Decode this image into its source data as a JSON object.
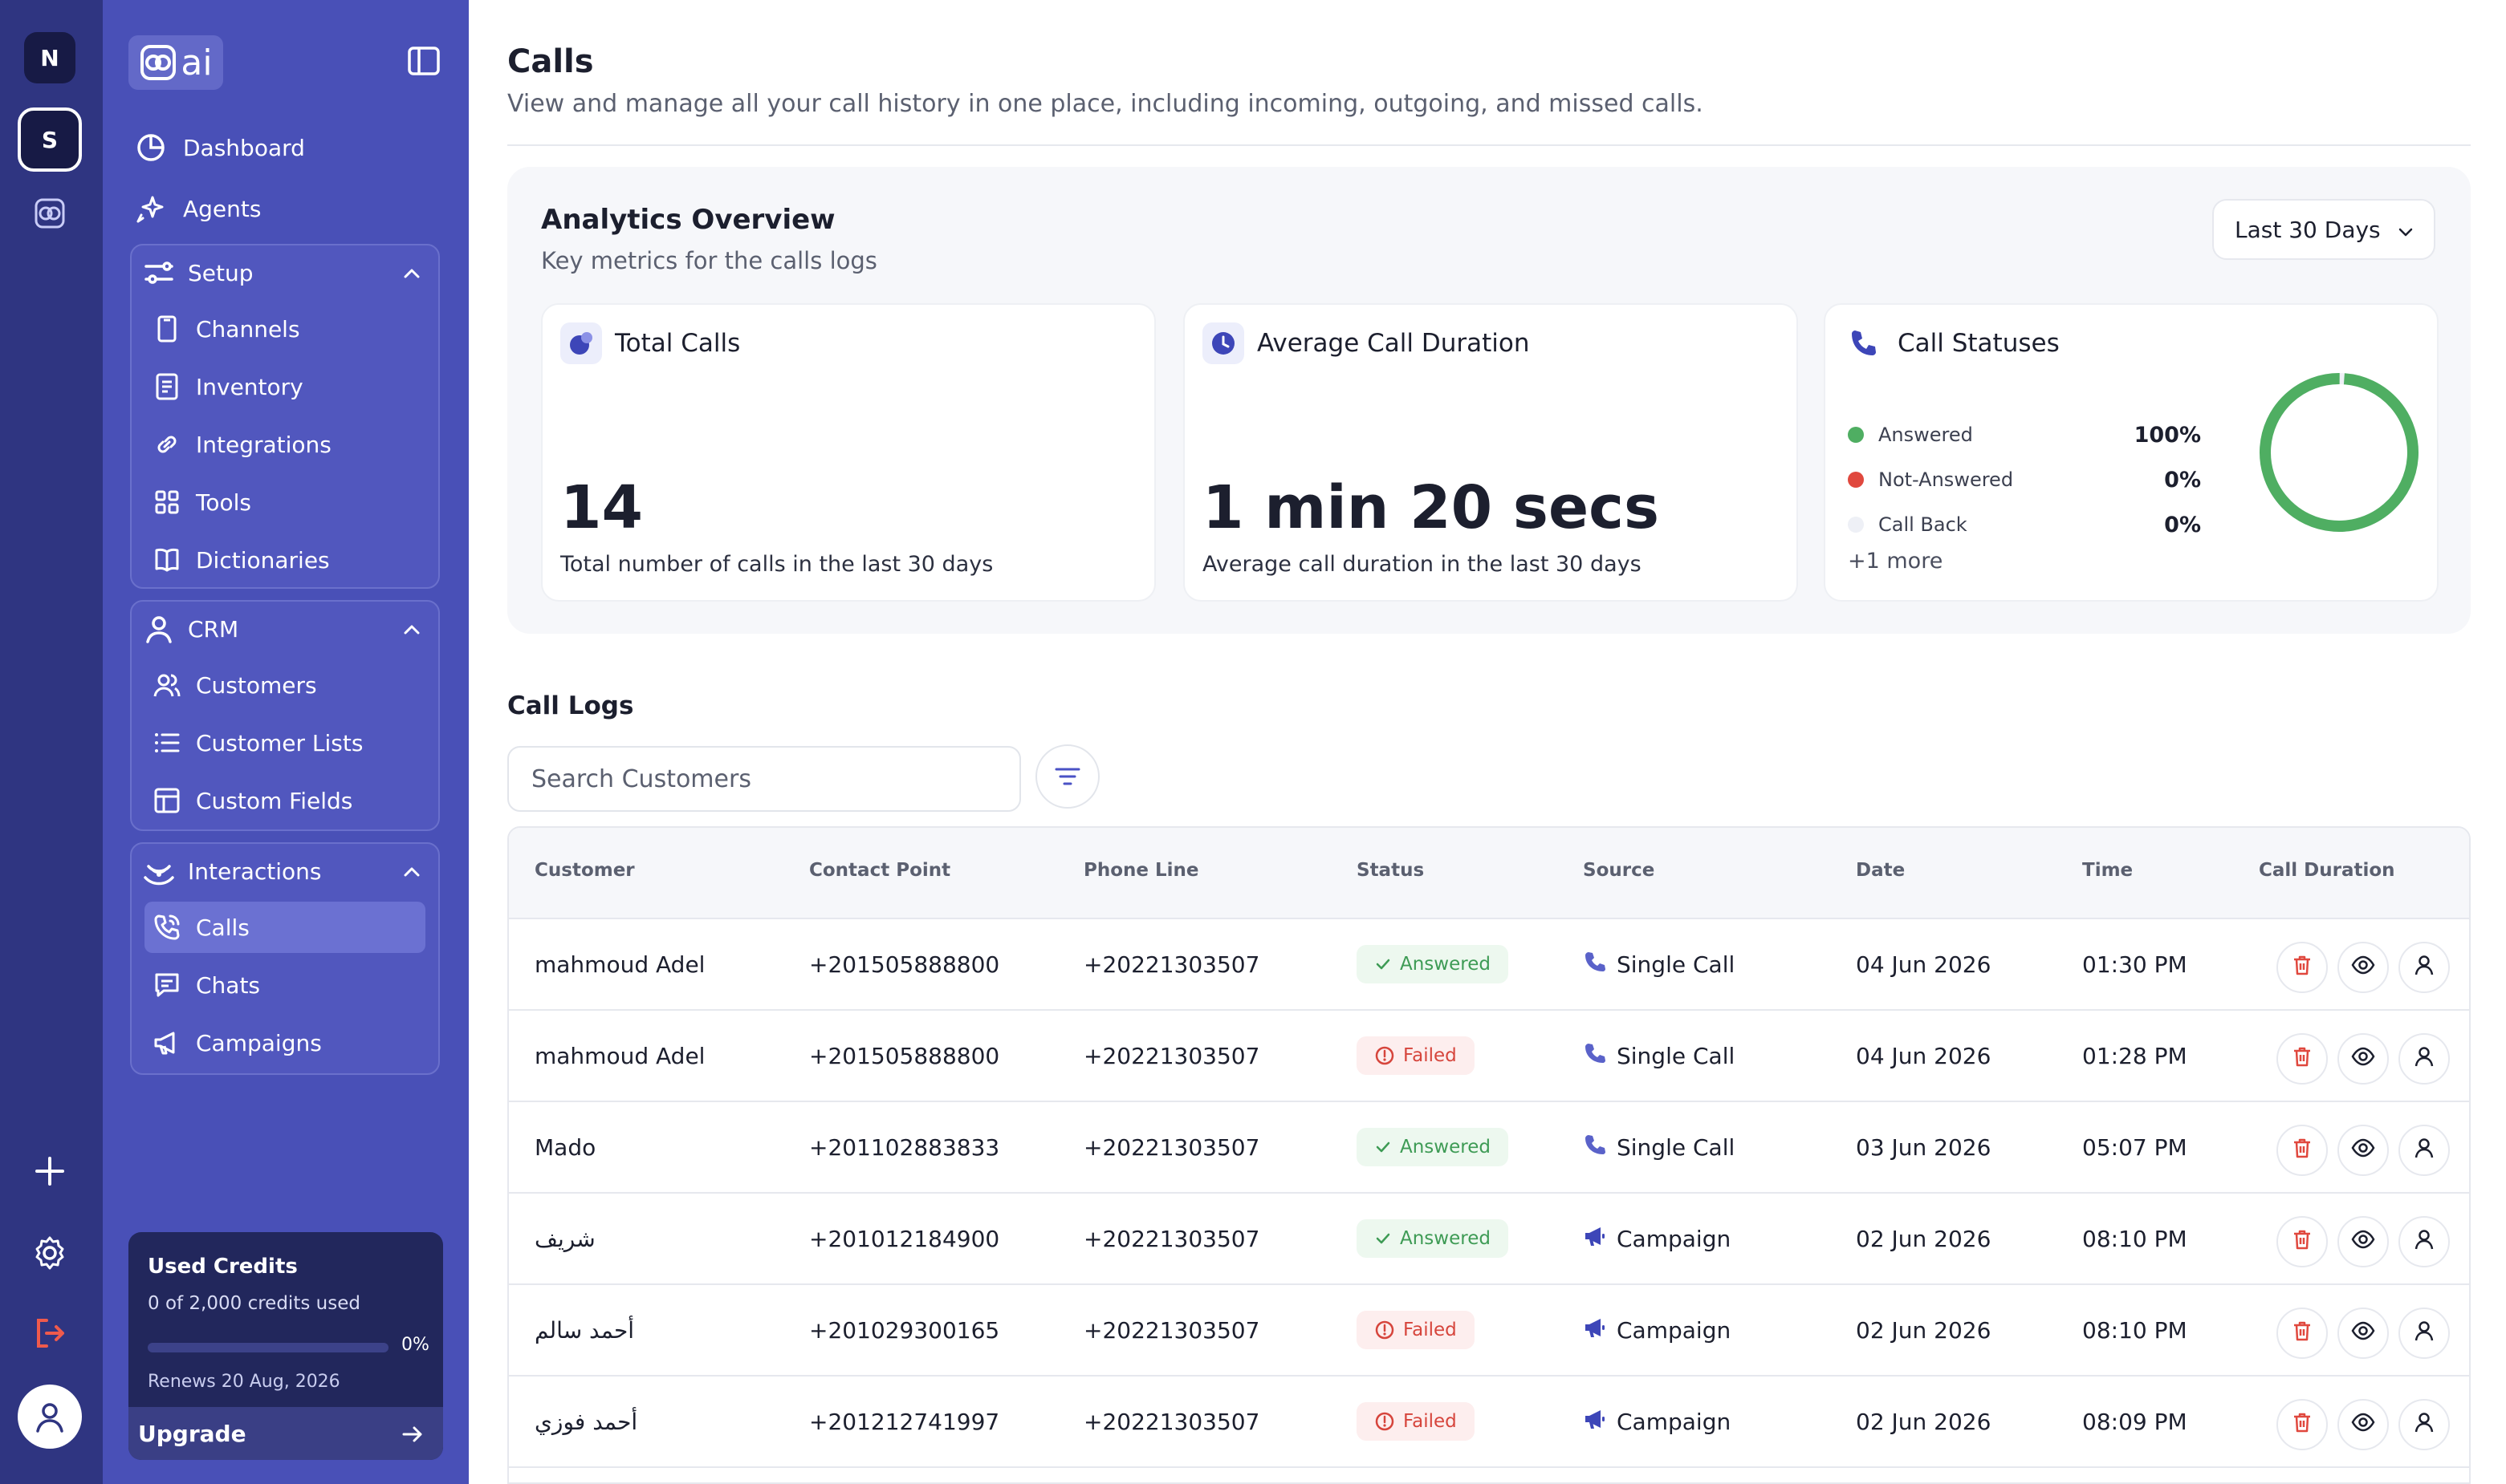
{
  "rail": {
    "workspaces": [
      {
        "initial": "N"
      },
      {
        "initial": "S"
      }
    ],
    "icons": [
      "brand-icon",
      "plus-icon",
      "settings-icon",
      "logout-icon",
      "user-avatar-icon"
    ]
  },
  "sidebar": {
    "logo_text": "ai",
    "top_items": [
      {
        "label": "Dashboard",
        "icon": "pie-chart-icon"
      },
      {
        "label": "Agents",
        "icon": "sparkles-icon"
      }
    ],
    "groups": [
      {
        "label": "Setup",
        "icon": "sliders-icon",
        "items": [
          {
            "label": "Channels",
            "icon": "device-icon"
          },
          {
            "label": "Inventory",
            "icon": "document-icon"
          },
          {
            "label": "Integrations",
            "icon": "link-icon"
          },
          {
            "label": "Tools",
            "icon": "grid-icon"
          },
          {
            "label": "Dictionaries",
            "icon": "book-icon"
          }
        ]
      },
      {
        "label": "CRM",
        "icon": "user-icon",
        "items": [
          {
            "label": "Customers",
            "icon": "users-icon"
          },
          {
            "label": "Customer Lists",
            "icon": "list-icon"
          },
          {
            "label": "Custom Fields",
            "icon": "table-icon"
          }
        ]
      },
      {
        "label": "Interactions",
        "icon": "signal-icon",
        "items": [
          {
            "label": "Calls",
            "icon": "phone-icon",
            "active": true
          },
          {
            "label": "Chats",
            "icon": "chat-icon"
          },
          {
            "label": "Campaigns",
            "icon": "megaphone-icon"
          }
        ]
      }
    ],
    "credits": {
      "title": "Used Credits",
      "usage": "0 of 2,000 credits used",
      "percent_label": "0%",
      "fraction": 0,
      "renews": "Renews 20 Aug, 2026",
      "upgrade_label": "Upgrade"
    }
  },
  "page": {
    "title": "Calls",
    "subtitle": "View and manage all your call history in one place, including incoming, outgoing, and missed calls."
  },
  "analytics": {
    "title": "Analytics Overview",
    "subtitle": "Key metrics for the calls logs",
    "range": "Last 30 Days",
    "total_calls": {
      "title": "Total Calls",
      "value": "14",
      "caption": "Total number of calls in the last 30 days"
    },
    "avg_duration": {
      "title": "Average Call Duration",
      "value": "1 min 20 secs",
      "caption": "Average call duration in the last 30 days"
    },
    "statuses": {
      "title": "Call Statuses",
      "items": [
        {
          "label": "Answered",
          "percent": "100%",
          "fraction": 1,
          "color": "#4fae62"
        },
        {
          "label": "Not-Answered",
          "percent": "0%",
          "fraction": 0,
          "color": "#e0483e"
        },
        {
          "label": "Call Back",
          "percent": "0%",
          "fraction": 0,
          "color": "#eef0f6"
        }
      ],
      "more": "+1 more"
    }
  },
  "logs": {
    "title": "Call Logs",
    "search_placeholder": "Search Customers",
    "columns": [
      "Customer",
      "Contact Point",
      "Phone Line",
      "Status",
      "Source",
      "Date",
      "Time",
      "Call Duration"
    ],
    "rows": [
      {
        "customer": "mahmoud Adel",
        "contact": "+201505888800",
        "line": "+20221303507",
        "status": "Answered",
        "ok": true,
        "source": "Single Call",
        "source_icon": "phone-icon",
        "date": "04 Jun 2026",
        "time": "01:30 PM"
      },
      {
        "customer": "mahmoud Adel",
        "contact": "+201505888800",
        "line": "+20221303507",
        "status": "Failed",
        "ok": false,
        "source": "Single Call",
        "source_icon": "phone-icon",
        "date": "04 Jun 2026",
        "time": "01:28 PM"
      },
      {
        "customer": "Mado",
        "contact": "+201102883833",
        "line": "+20221303507",
        "status": "Answered",
        "ok": true,
        "source": "Single Call",
        "source_icon": "phone-icon",
        "date": "03 Jun 2026",
        "time": "05:07 PM"
      },
      {
        "customer": "شريف",
        "contact": "+201012184900",
        "line": "+20221303507",
        "status": "Answered",
        "ok": true,
        "source": "Campaign",
        "source_icon": "megaphone-icon",
        "date": "02 Jun 2026",
        "time": "08:10 PM"
      },
      {
        "customer": "أحمد سالم",
        "contact": "+201029300165",
        "line": "+20221303507",
        "status": "Failed",
        "ok": false,
        "source": "Campaign",
        "source_icon": "megaphone-icon",
        "date": "02 Jun 2026",
        "time": "08:10 PM"
      },
      {
        "customer": "أحمد فوزي",
        "contact": "+201212741997",
        "line": "+20221303507",
        "status": "Failed",
        "ok": false,
        "source": "Campaign",
        "source_icon": "megaphone-icon",
        "date": "02 Jun 2026",
        "time": "08:09 PM"
      }
    ]
  },
  "colors": {
    "rail": "#2f3581",
    "sidebar": "#4950b7",
    "accent": "#4a52c5",
    "answered": "#4fae62",
    "failed": "#e0483e"
  }
}
